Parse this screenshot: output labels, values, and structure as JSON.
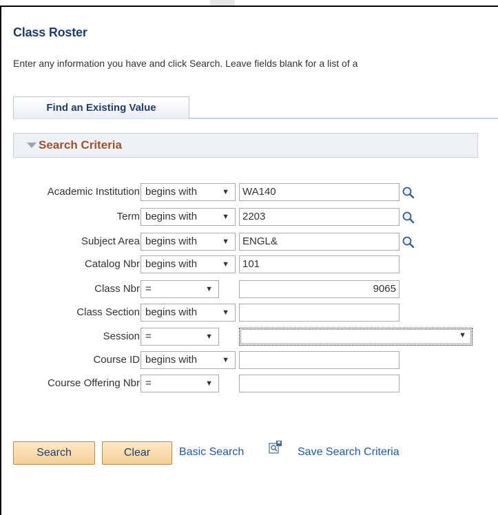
{
  "page": {
    "title": "Class Roster",
    "instructions": "Enter any information you have and click Search. Leave fields blank for a list of a"
  },
  "tabs": [
    {
      "label": "Find an Existing Value",
      "active": true
    }
  ],
  "criteria": {
    "header": "Search Criteria"
  },
  "fields": [
    {
      "label": "Academic Institution",
      "operator": "begins with",
      "value": "WA140",
      "lookup": true
    },
    {
      "label": "Term",
      "operator": "begins with",
      "value": "2203",
      "lookup": true
    },
    {
      "label": "Subject Area",
      "operator": "begins with",
      "value": "ENGL&",
      "lookup": true
    },
    {
      "label": "Catalog Nbr",
      "operator": "begins with",
      "value": "101",
      "lookup": false
    },
    {
      "label": "Class Nbr",
      "operator": "=",
      "value": "9065",
      "lookup": false
    },
    {
      "label": "Class Section",
      "operator": "begins with",
      "value": "",
      "lookup": false
    },
    {
      "label": "Session",
      "operator": "=",
      "value": "",
      "lookup": false
    },
    {
      "label": "Course ID",
      "operator": "begins with",
      "value": "",
      "lookup": false
    },
    {
      "label": "Course Offering Nbr",
      "operator": "=",
      "value": "",
      "lookup": false
    }
  ],
  "actions": {
    "search_label": "Search",
    "clear_label": "Clear",
    "basic_search_label": "Basic Search",
    "save_criteria_label": "Save Search Criteria"
  },
  "icons": {
    "lookup": "magnifier-icon",
    "save": "save-search-icon",
    "collapse": "triangle-down-icon",
    "dropdown": "dropdown-arrow-icon"
  },
  "colors": {
    "title": "#1f3d6e",
    "criteria_header": "#a0522d",
    "link": "#1f5aa6",
    "button_bg": "#f4cf93"
  }
}
